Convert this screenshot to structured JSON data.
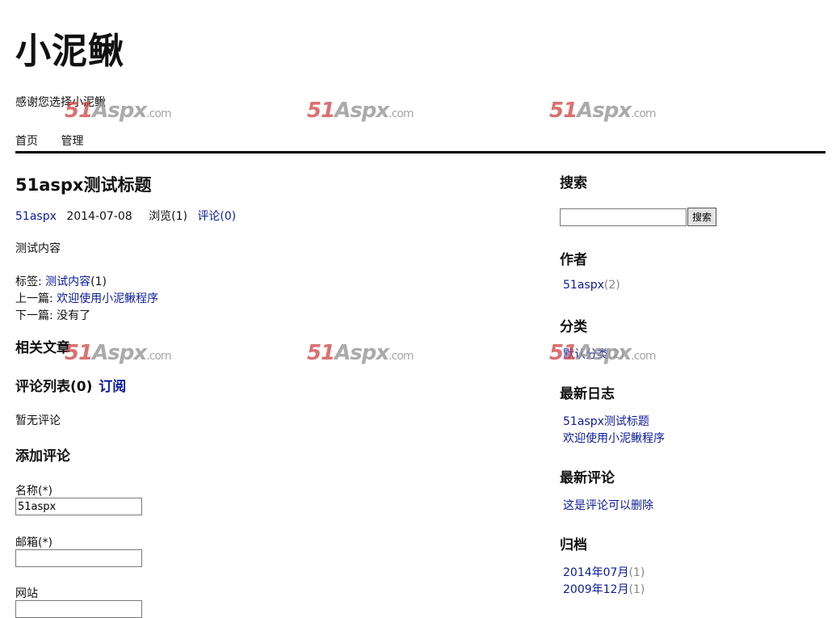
{
  "site": {
    "title": "小泥鳅",
    "tagline": "感谢您选择小泥鳅",
    "nav": [
      "首页",
      "管理"
    ]
  },
  "post": {
    "title": "51aspx测试标题",
    "author": "51aspx",
    "date": "2014-07-08",
    "views": "浏览(1)",
    "comments_link": "评论(0)",
    "content": "测试内容",
    "tags_label": "标签:",
    "tag": "测试内容",
    "tag_count": "(1)",
    "prev_label": "上一篇:",
    "prev_link": "欢迎使用小泥鳅程序",
    "next_label": "下一篇:",
    "next_text": "没有了"
  },
  "related_heading": "相关文章",
  "comments": {
    "heading": "评论列表(0)",
    "subscribe": "订阅",
    "empty": "暂无评论"
  },
  "form": {
    "heading": "添加评论",
    "name_label": "名称(*)",
    "name_value": "51aspx",
    "email_label": "邮箱(*)",
    "email_value": "",
    "site_label": "网站"
  },
  "sidebar": {
    "search_heading": "搜索",
    "search_button": "搜索",
    "authors_heading": "作者",
    "author_name": "51aspx",
    "author_count": "(2)",
    "categories_heading": "分类",
    "category_name": "默认分类",
    "category_count": "(2)",
    "recent_posts_heading": "最新日志",
    "recent_posts": [
      "51aspx测试标题",
      "欢迎使用小泥鳅程序"
    ],
    "recent_comments_heading": "最新评论",
    "recent_comment": "这是评论可以删除",
    "archive_heading": "归档",
    "archives": [
      {
        "month": "2014年07月",
        "count": "(1)"
      },
      {
        "month": "2009年12月",
        "count": "(1)"
      }
    ]
  },
  "watermark": {
    "brand": "51",
    "mid": "Aspx",
    "suffix": ".com"
  }
}
